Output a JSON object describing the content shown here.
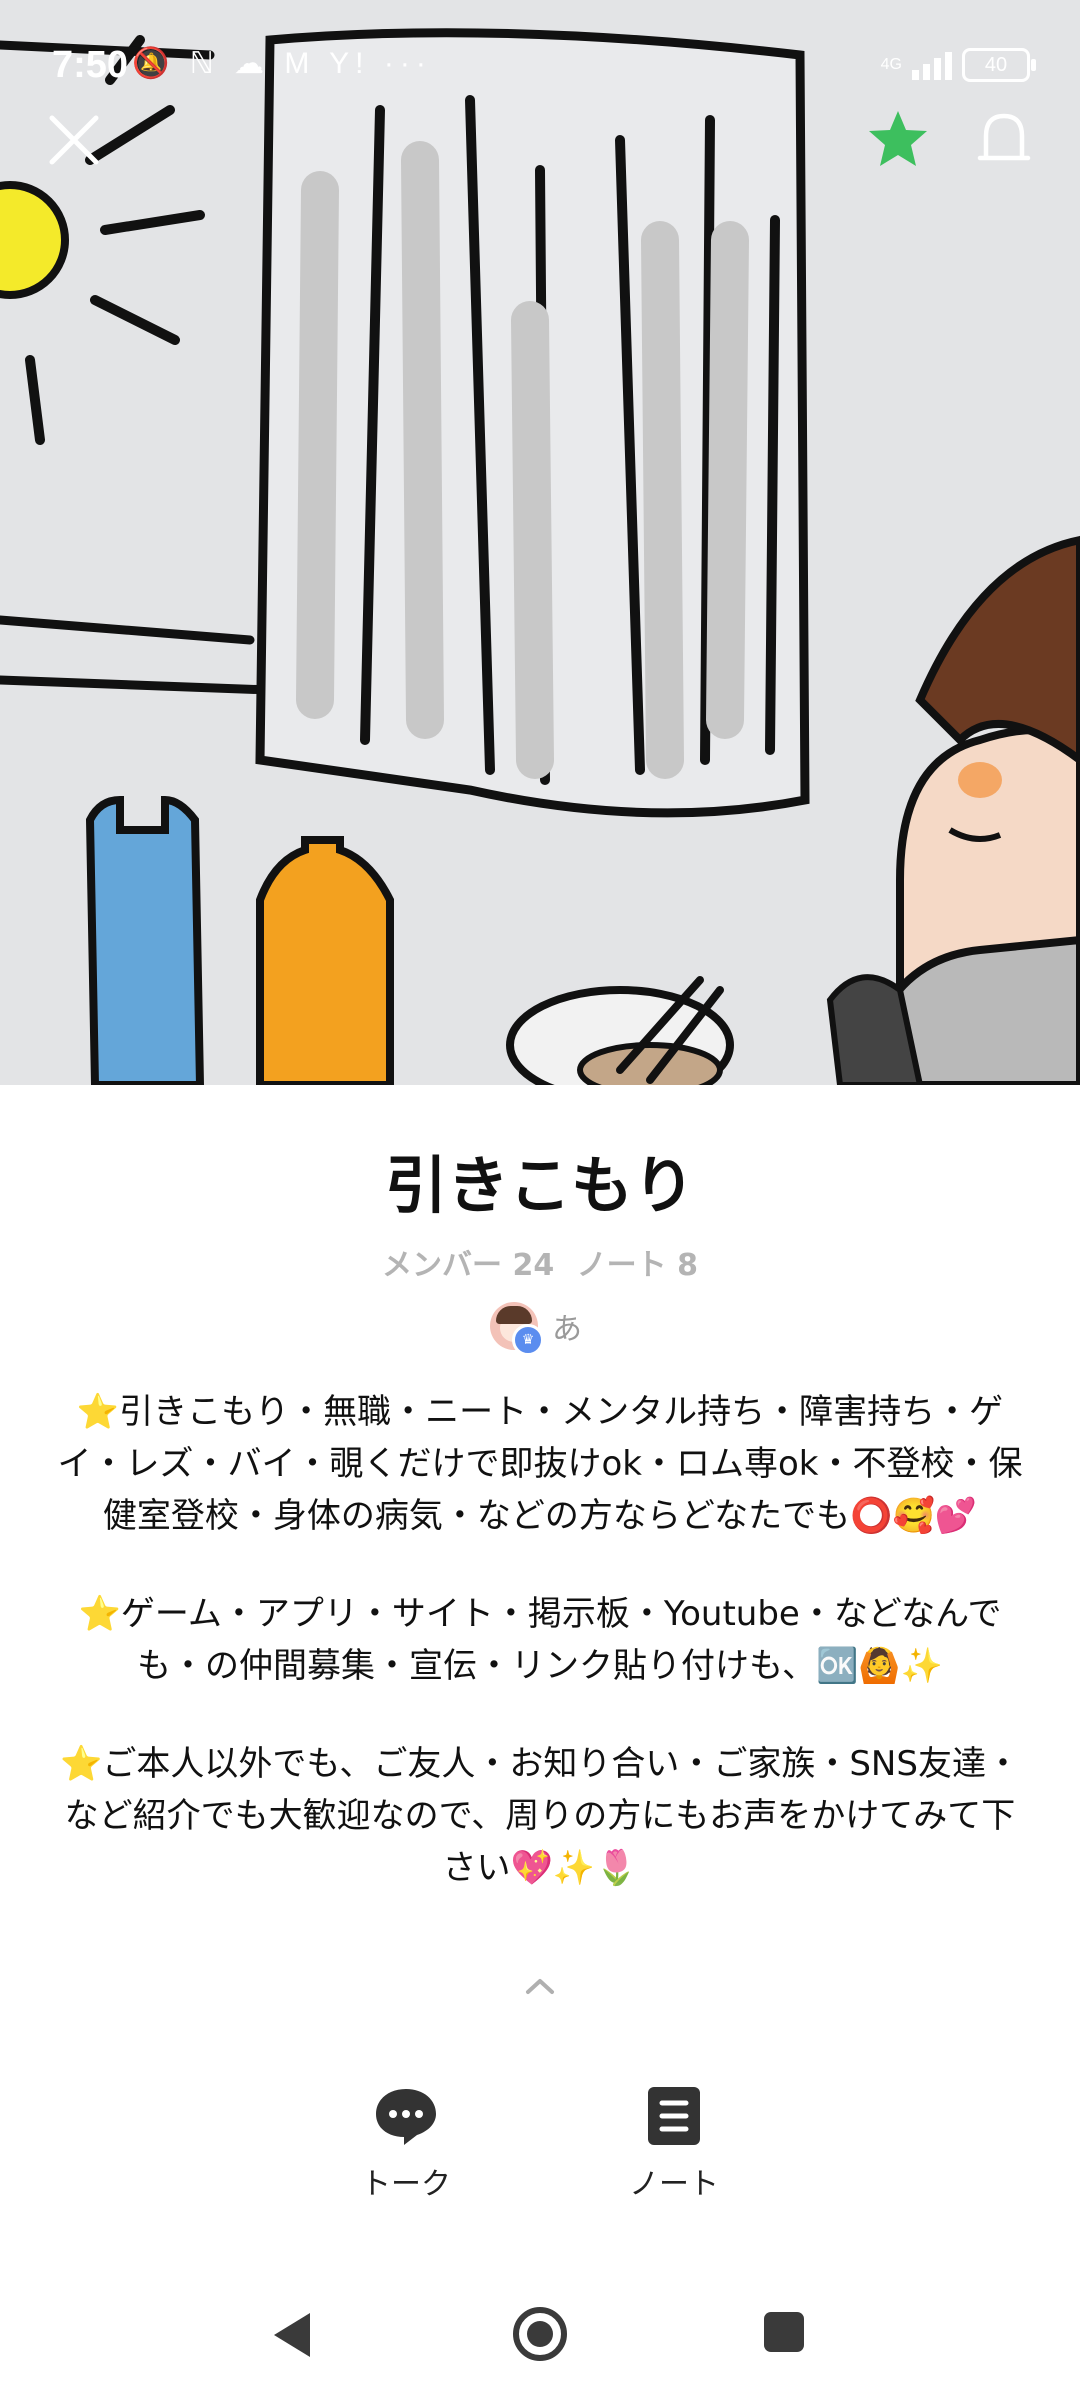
{
  "status_bar": {
    "time": "7:50",
    "left_icons": "🔕 ℕ ☁ M Y! ···",
    "network": "4G",
    "battery": "40"
  },
  "header": {
    "close_icon": "close-icon",
    "favorite_icon": "star-icon",
    "favorite_color": "#3dbf5e",
    "notify_icon": "bell-icon"
  },
  "group": {
    "title": "引きこもり",
    "members_label": "メンバー 24",
    "notes_label": "ノート 8",
    "owner_name": "あ"
  },
  "description": {
    "p1": "⭐引きこもり・無職・ニート・メンタル持ち・障害持ち・ゲイ・レズ・バイ・覗くだけで即抜けok・ロム専ok・不登校・保健室登校・身体の病気・などの方ならどなたでも⭕🥰💕",
    "p2": "⭐ゲーム・アプリ・サイト・掲示板・Youtube・などなんでも・の仲間募集・宣伝・リンク貼り付けも、🆗🙆✨",
    "p3": "⭐ご本人以外でも、ご友人・お知り合い・ご家族・SNS友達・など紹介でも大歓迎なので、周りの方にもお声をかけてみて下さい💖✨🌷"
  },
  "tabs": [
    {
      "label": "トーク",
      "icon": "chat-bubble-icon"
    },
    {
      "label": "ノート",
      "icon": "note-icon"
    }
  ],
  "nav": {
    "back_icon": "back-icon",
    "home_icon": "home-icon",
    "recent_icon": "recent-apps-icon"
  }
}
